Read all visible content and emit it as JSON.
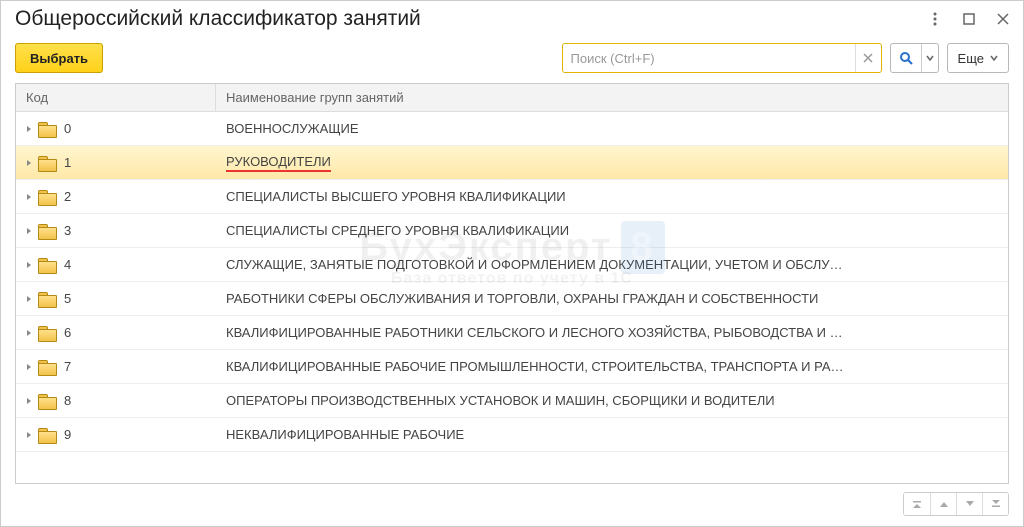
{
  "window": {
    "title": "Общероссийский классификатор занятий"
  },
  "toolbar": {
    "select_label": "Выбрать",
    "more_label": "Еще"
  },
  "search": {
    "placeholder": "Поиск (Ctrl+F)",
    "value": ""
  },
  "table": {
    "columns": {
      "code": "Код",
      "name": "Наименование групп занятий"
    },
    "rows": [
      {
        "code": "0",
        "name": "ВОЕННОСЛУЖАЩИЕ",
        "selected": false,
        "highlight": false
      },
      {
        "code": "1",
        "name": "РУКОВОДИТЕЛИ",
        "selected": true,
        "highlight": true
      },
      {
        "code": "2",
        "name": "СПЕЦИАЛИСТЫ ВЫСШЕГО УРОВНЯ КВАЛИФИКАЦИИ",
        "selected": false,
        "highlight": false
      },
      {
        "code": "3",
        "name": "СПЕЦИАЛИСТЫ СРЕДНЕГО УРОВНЯ КВАЛИФИКАЦИИ",
        "selected": false,
        "highlight": false
      },
      {
        "code": "4",
        "name": "СЛУЖАЩИЕ, ЗАНЯТЫЕ ПОДГОТОВКОЙ И ОФОРМЛЕНИЕМ ДОКУМЕНТАЦИИ, УЧЕТОМ И ОБСЛУ…",
        "selected": false,
        "highlight": false
      },
      {
        "code": "5",
        "name": "РАБОТНИКИ СФЕРЫ ОБСЛУЖИВАНИЯ И ТОРГОВЛИ, ОХРАНЫ ГРАЖДАН И СОБСТВЕННОСТИ",
        "selected": false,
        "highlight": false
      },
      {
        "code": "6",
        "name": "КВАЛИФИЦИРОВАННЫЕ РАБОТНИКИ СЕЛЬСКОГО И ЛЕСНОГО ХОЗЯЙСТВА, РЫБОВОДСТВА И …",
        "selected": false,
        "highlight": false
      },
      {
        "code": "7",
        "name": "КВАЛИФИЦИРОВАННЫЕ РАБОЧИЕ ПРОМЫШЛЕННОСТИ, СТРОИТЕЛЬСТВА, ТРАНСПОРТА И РА…",
        "selected": false,
        "highlight": false
      },
      {
        "code": "8",
        "name": "ОПЕРАТОРЫ ПРОИЗВОДСТВЕННЫХ УСТАНОВОК И МАШИН, СБОРЩИКИ И ВОДИТЕЛИ",
        "selected": false,
        "highlight": false
      },
      {
        "code": "9",
        "name": "НЕКВАЛИФИЦИРОВАННЫЕ РАБОЧИЕ",
        "selected": false,
        "highlight": false
      }
    ]
  },
  "watermark": {
    "line1": "БухЭксперт",
    "badge": "8",
    "line2": "База ответов по учету в 1С"
  }
}
